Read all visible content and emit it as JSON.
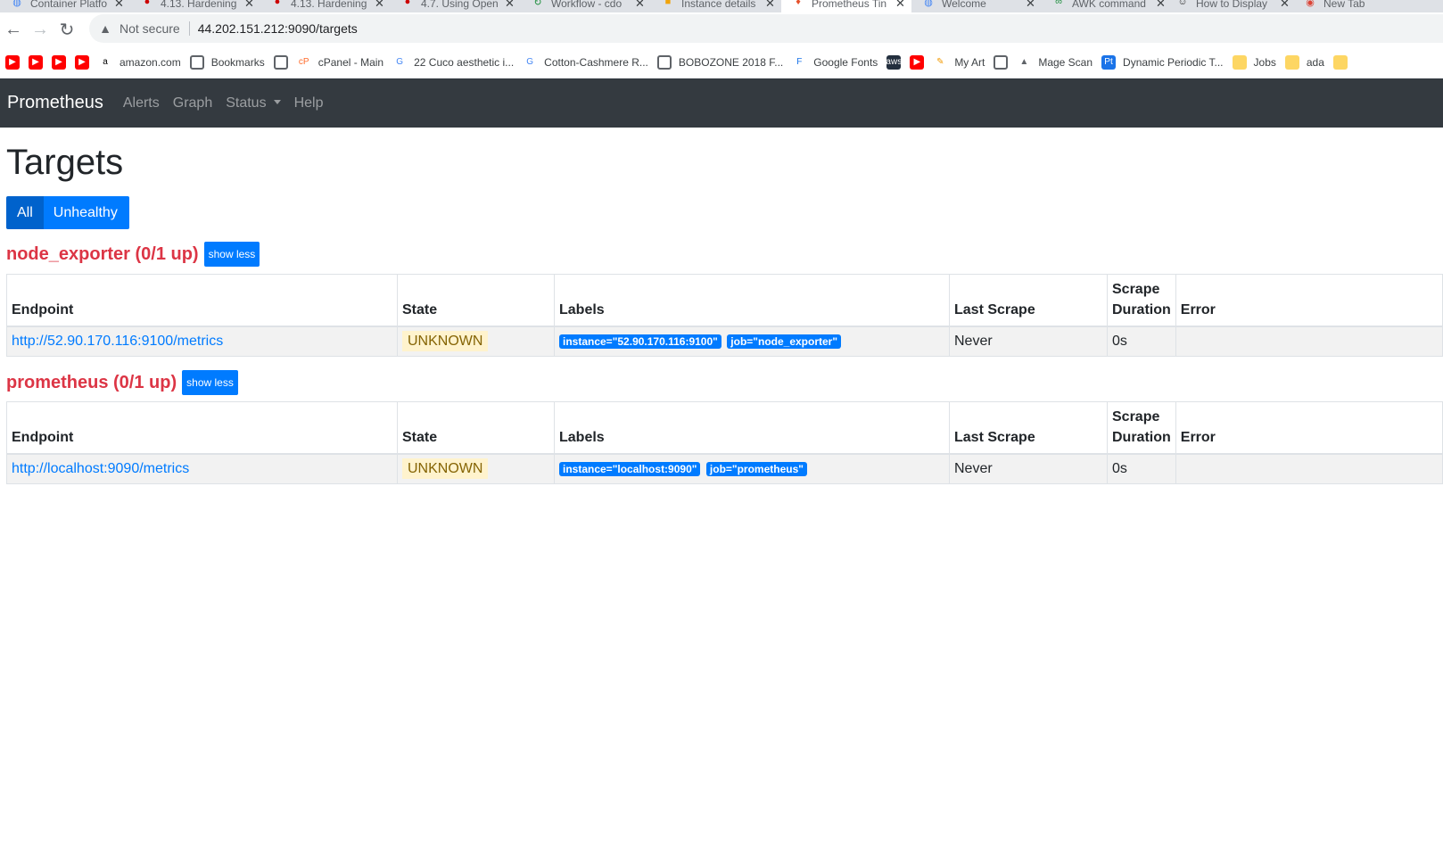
{
  "browser": {
    "tabs": [
      {
        "title": "Container Platfo",
        "icon": "globe-icon"
      },
      {
        "title": "4.13. Hardening",
        "icon": "redhat-icon"
      },
      {
        "title": "4.13. Hardening",
        "icon": "redhat-icon"
      },
      {
        "title": "4.7. Using Open",
        "icon": "redhat-icon"
      },
      {
        "title": "Workflow - cdo",
        "icon": "refresh-green-icon"
      },
      {
        "title": "Instance details",
        "icon": "aws-box-icon"
      },
      {
        "title": "Prometheus Tin",
        "icon": "prometheus-flame-icon"
      },
      {
        "title": "Welcome",
        "icon": "globe-icon"
      },
      {
        "title": "AWK command",
        "icon": "link-icon"
      },
      {
        "title": "How to Display",
        "icon": "linux-tux-icon"
      },
      {
        "title": "New Tab",
        "icon": "chrome-icon"
      }
    ],
    "address": {
      "security_label": "Not secure",
      "url": "44.202.151.212:9090/targets"
    },
    "bookmarks": [
      {
        "label": "",
        "icon": "youtube-icon"
      },
      {
        "label": "",
        "icon": "youtube-icon"
      },
      {
        "label": "",
        "icon": "youtube-icon"
      },
      {
        "label": "",
        "icon": "youtube-icon"
      },
      {
        "label": "amazon.com",
        "icon": "amazon-icon"
      },
      {
        "label": "Bookmarks",
        "icon": "globe-icon"
      },
      {
        "label": "",
        "icon": "globe-icon"
      },
      {
        "label": "cPanel - Main",
        "icon": "cpanel-icon"
      },
      {
        "label": "22 Cuco aesthetic i...",
        "icon": "google-icon"
      },
      {
        "label": "Cotton-Cashmere R...",
        "icon": "google-icon"
      },
      {
        "label": "BOBOZONE 2018 F...",
        "icon": "globe-icon"
      },
      {
        "label": "Google Fonts",
        "icon": "google-fonts-icon"
      },
      {
        "label": "",
        "icon": "aws-icon"
      },
      {
        "label": "",
        "icon": "youtube-icon"
      },
      {
        "label": "My Art",
        "icon": "art-icon"
      },
      {
        "label": "",
        "icon": "globe-icon"
      },
      {
        "label": "Mage Scan",
        "icon": "mage-icon"
      },
      {
        "label": "Dynamic Periodic T...",
        "icon": "pt-icon"
      },
      {
        "label": "Jobs",
        "icon": "folder-icon"
      },
      {
        "label": "ada",
        "icon": "folder-icon"
      },
      {
        "label": "",
        "icon": "folder-icon"
      }
    ]
  },
  "navbar": {
    "brand": "Prometheus",
    "links": {
      "alerts": "Alerts",
      "graph": "Graph",
      "status": "Status",
      "help": "Help"
    }
  },
  "page": {
    "title": "Targets",
    "filter": {
      "all": "All",
      "unhealthy": "Unhealthy"
    }
  },
  "columns": {
    "endpoint": "Endpoint",
    "state": "State",
    "labels": "Labels",
    "last_scrape": "Last Scrape",
    "scrape_duration_1": "Scrape",
    "scrape_duration_2": "Duration",
    "error": "Error"
  },
  "pools": [
    {
      "title": "node_exporter (0/1 up)",
      "toggle": "show less",
      "targets": [
        {
          "endpoint": "http://52.90.170.116:9100/metrics",
          "state": "UNKNOWN",
          "labels": [
            "instance=\"52.90.170.116:9100\"",
            "job=\"node_exporter\""
          ],
          "last_scrape": "Never",
          "scrape_duration": "0s",
          "error": ""
        }
      ]
    },
    {
      "title": "prometheus (0/1 up)",
      "toggle": "show less",
      "targets": [
        {
          "endpoint": "http://localhost:9090/metrics",
          "state": "UNKNOWN",
          "labels": [
            "instance=\"localhost:9090\"",
            "job=\"prometheus\""
          ],
          "last_scrape": "Never",
          "scrape_duration": "0s",
          "error": ""
        }
      ]
    }
  ],
  "colors": {
    "navbar": "#343a40",
    "primary": "#007bff",
    "danger": "#dc3545",
    "warning_bg": "#fff3cd"
  }
}
